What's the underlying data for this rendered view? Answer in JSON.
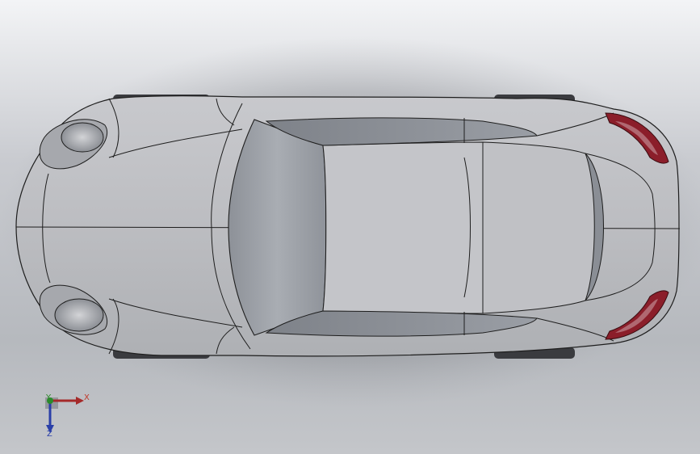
{
  "viewport": {
    "background_top": "#f3f4f6",
    "background_bottom": "#b6b9be",
    "model": "car-body-top-view"
  },
  "colors": {
    "body": "#bdbec2",
    "body_highlight": "#d7d8db",
    "glass": "#9fa3aa",
    "edge": "#1e1e1e",
    "taillight": "#8b1e2a"
  },
  "triad": {
    "x_label": "X",
    "y_label": "Y",
    "z_label": "Z",
    "x_color": "#c0392b",
    "y_color": "#2a8a2a",
    "z_color": "#2a3fa8"
  }
}
